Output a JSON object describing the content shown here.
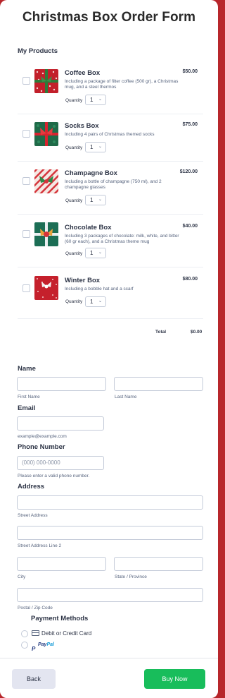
{
  "form": {
    "title": "Christmas Box Order Form",
    "products_label": "My Products",
    "products": [
      {
        "name": "Coffee Box",
        "price": "$50.00",
        "description": "Including a package of filter coffee (500 gr), a Christmas mug, and a steel thermos",
        "quantity_label": "Quantity",
        "quantity": "1",
        "icon": "gift-polka-red-icon"
      },
      {
        "name": "Socks Box",
        "price": "$75.00",
        "description": "Including 4 pairs of Christmas themed socks",
        "quantity_label": "Quantity",
        "quantity": "1",
        "icon": "gift-green-red-bow-icon"
      },
      {
        "name": "Champagne Box",
        "price": "$120.00",
        "description": "Including a bottle of champagne (750 ml), and 2 champagne glasses",
        "quantity_label": "Quantity",
        "quantity": "1",
        "icon": "gift-striped-icon"
      },
      {
        "name": "Chocolate Box",
        "price": "$40.00",
        "description": "Including 3 packages of chocolate: milk, white, and bitter (60 gr each), and a Christmas theme mug",
        "quantity_label": "Quantity",
        "quantity": "1",
        "icon": "gift-green-gold-bow-icon"
      },
      {
        "name": "Winter Box",
        "price": "$80.00",
        "description": "Including a bobble hat and a scarf",
        "quantity_label": "Quantity",
        "quantity": "1",
        "icon": "gift-red-dots-icon"
      }
    ],
    "total_label": "Total",
    "total_value": "$0.00",
    "name": {
      "label": "Name",
      "first_sub": "First Name",
      "last_sub": "Last Name"
    },
    "email": {
      "label": "Email",
      "sub": "example@example.com"
    },
    "phone": {
      "label": "Phone Number",
      "placeholder": "(000) 000-0000",
      "sub": "Please enter a valid phone number."
    },
    "address": {
      "label": "Address",
      "street": "Street Address",
      "street2": "Street Address Line 2",
      "city": "City",
      "state": "State / Province",
      "postal": "Postal / Zip Code"
    },
    "payment": {
      "label": "Payment Methods",
      "card": "Debit or Credit Card",
      "paypal_pay": "Pay",
      "paypal_pal": "Pal"
    },
    "colors": {
      "accent_green": "#18bd5b",
      "background_red": "#b8262b"
    }
  },
  "footer": {
    "back_label": "Back",
    "buy_label": "Buy Now"
  }
}
